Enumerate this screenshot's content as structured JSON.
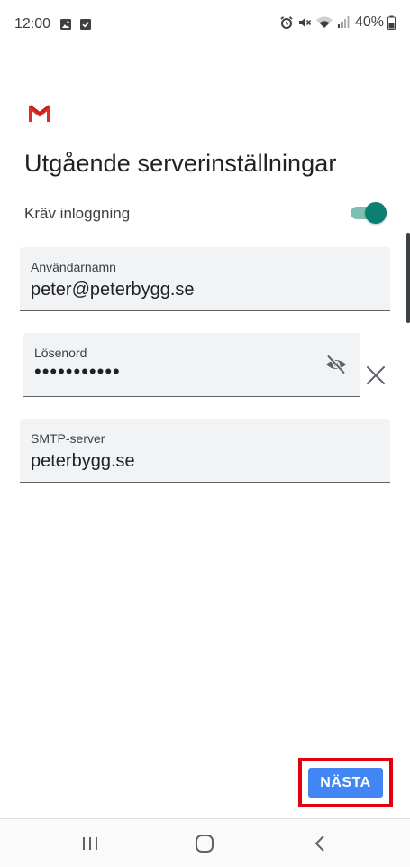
{
  "status_bar": {
    "time": "12:00",
    "battery": "40%",
    "left_icons": [
      "image-icon",
      "check-box-icon"
    ],
    "right_icons": [
      "alarm-icon",
      "mute-icon",
      "wifi-icon",
      "signal-icon",
      "battery-icon"
    ]
  },
  "app": {
    "logo": "gmail-logo-icon",
    "title": "Utgående serverinställningar"
  },
  "require_login": {
    "label": "Kräv inloggning",
    "enabled": true,
    "accent_color": "#0b8072"
  },
  "fields": {
    "username": {
      "label": "Användarnamn",
      "value": "peter@peterbygg.se"
    },
    "password": {
      "label": "Lösenord",
      "value": "•••••••••••",
      "visibility_icon": "visibility-off-icon",
      "clear_icon": "close-icon"
    },
    "smtp": {
      "label": "SMTP-server",
      "value": "peterbygg.se"
    }
  },
  "actions": {
    "next_label": "NÄSTA",
    "next_color": "#4285f4",
    "highlight_color": "#e0000f"
  },
  "nav_bar": {
    "icons": [
      "recents-icon",
      "home-icon",
      "back-icon"
    ]
  }
}
